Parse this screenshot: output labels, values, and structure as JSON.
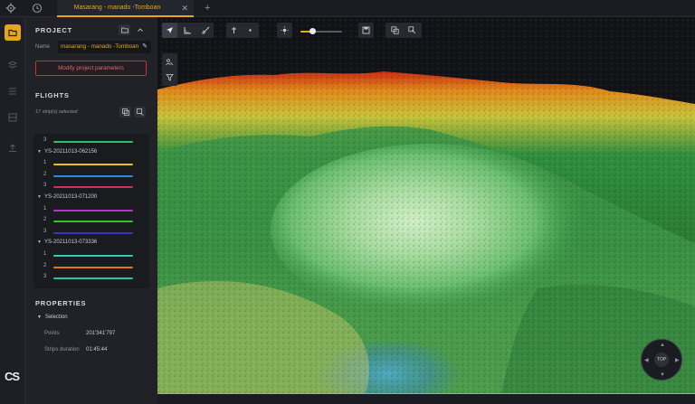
{
  "tabs": [
    {
      "title": "Masarang - manado -Tomboan",
      "active": true
    }
  ],
  "project": {
    "section_title": "PROJECT",
    "name_label": "Name",
    "name_value": "masarang - manado -Tomboan",
    "modify_button": "Modify project parameters"
  },
  "flights": {
    "section_title": "FLIGHTS",
    "strips_selected": "17 strip(s) selected",
    "rows": [
      {
        "type": "strip",
        "num": "3",
        "color": "#23c46a"
      },
      {
        "type": "group",
        "name": "YS-20211013-062156"
      },
      {
        "type": "strip",
        "num": "1",
        "color": "#e6c020"
      },
      {
        "type": "strip",
        "num": "2",
        "color": "#2a8ae0"
      },
      {
        "type": "strip",
        "num": "3",
        "color": "#d12f64"
      },
      {
        "type": "group",
        "name": "YS-20211013-071200"
      },
      {
        "type": "strip",
        "num": "1",
        "color": "#b237c9"
      },
      {
        "type": "strip",
        "num": "2",
        "color": "#35c42f"
      },
      {
        "type": "strip",
        "num": "3",
        "color": "#3a33c4"
      },
      {
        "type": "group",
        "name": "YS-20211013-073336"
      },
      {
        "type": "strip",
        "num": "1",
        "color": "#23d0b8"
      },
      {
        "type": "strip",
        "num": "2",
        "color": "#e07a18"
      },
      {
        "type": "strip",
        "num": "3",
        "color": "#23c4a8"
      }
    ]
  },
  "properties": {
    "section_title": "PROPERTIES",
    "selection_label": "Selection",
    "points_label": "Points",
    "points_value": "201'341'797",
    "duration_label": "Strips duration",
    "duration_value": "01:45:44"
  },
  "viewport": {
    "point_size_level": 0.3,
    "compass_label": "TOP",
    "colormap": [
      "#2a6fb0",
      "#6cc6c0",
      "#b9e3a6",
      "#3f9a46",
      "#1e6b2f",
      "#c7c23a",
      "#e08a1a",
      "#c92b14"
    ]
  },
  "branding": {
    "logo_text": "CS",
    "accent": "#e6a817"
  },
  "icons": {
    "settings": "gear-icon",
    "history": "clock-icon",
    "add_tab": "plus-icon",
    "folder": "folder-icon",
    "navigate": "cursor-arrow-icon",
    "measure": "ruler-icon",
    "classify": "brush-icon",
    "point_size": "sun-icon",
    "export": "save-icon",
    "filter": "filter-icon"
  }
}
